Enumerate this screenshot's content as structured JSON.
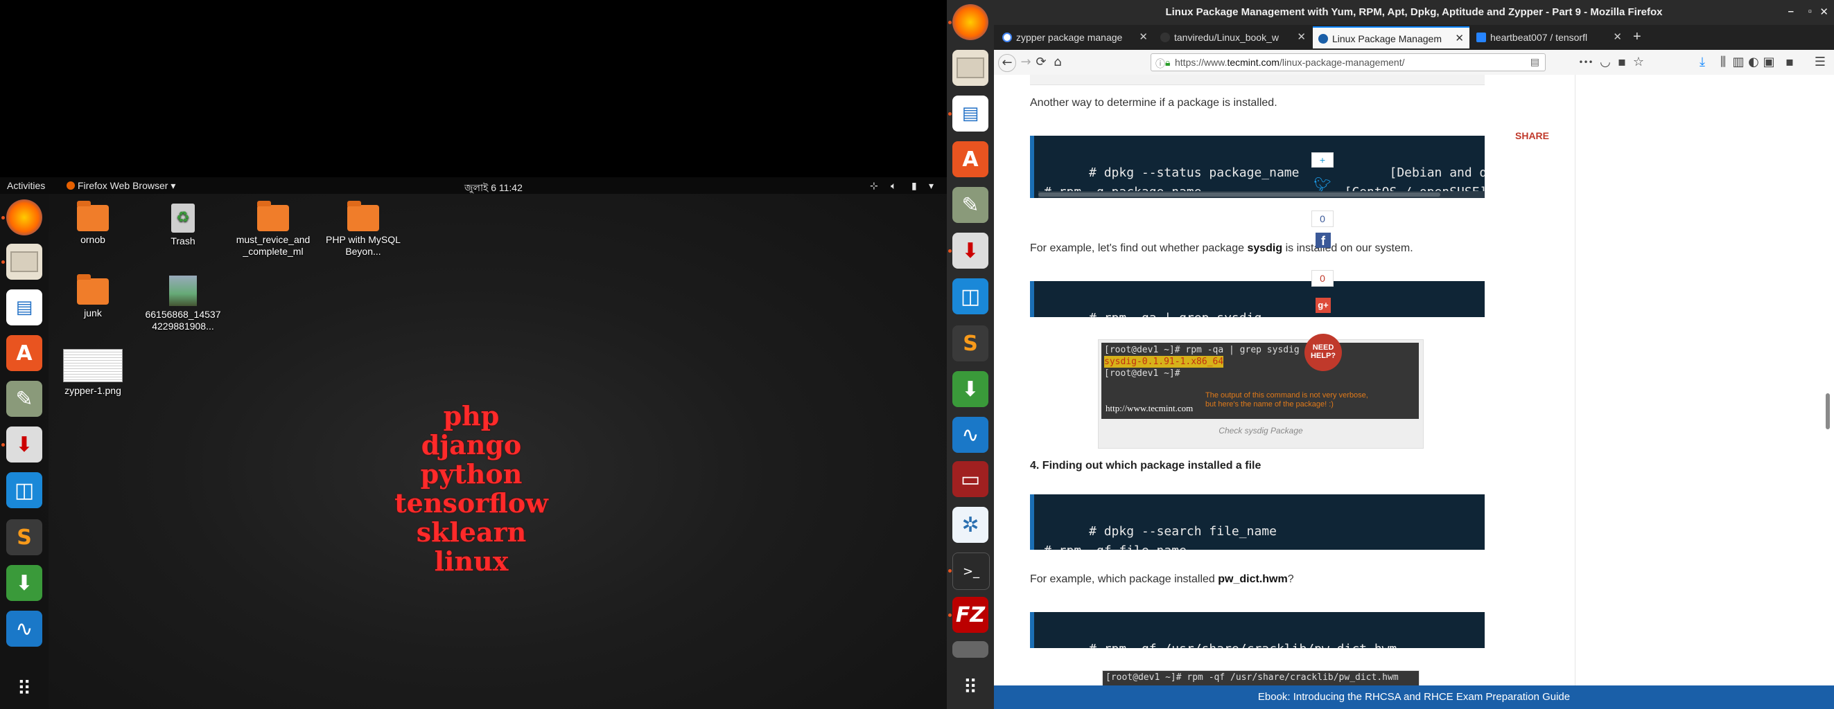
{
  "left_screen": {
    "topbar": {
      "activities": "Activities",
      "app_menu": "Firefox Web Browser",
      "app_menu_caret": "▾",
      "clock": "জুলাই 6  11:42",
      "tray_icons": [
        "network-icon",
        "volume-icon",
        "battery-icon",
        "caret-down-icon"
      ]
    },
    "desktop_items": [
      {
        "label": "ornob",
        "type": "folder-home"
      },
      {
        "label": "Trash",
        "type": "trash"
      },
      {
        "label": "must_revice_and_complete_ml",
        "type": "folder"
      },
      {
        "label": "PHP with MySQL Beyon...",
        "type": "folder"
      },
      {
        "label": "junk",
        "type": "folder"
      },
      {
        "label": "66156868_145374229881908...",
        "type": "image"
      },
      {
        "label": "zypper-1.png",
        "type": "image"
      }
    ],
    "wordcloud": [
      "php",
      "django",
      "python",
      "tensorflow",
      "sklearn",
      "linux"
    ],
    "dock": [
      "firefox-icon",
      "files-icon",
      "writer-icon",
      "software-center-icon",
      "editor-icon",
      "installer-icon",
      "app-icon",
      "sublime-icon",
      "download-icon",
      "monitor-icon",
      "apps-grid-icon"
    ]
  },
  "firefox": {
    "window_title": "Linux Package Management with Yum, RPM, Apt, Dpkg, Aptitude and Zypper - Part 9 - Mozilla Firefox",
    "window_controls": [
      "–",
      "▫",
      "✕"
    ],
    "tabs": [
      {
        "label": "zypper package manage",
        "active": false
      },
      {
        "label": "tanviredu/Linux_book_w",
        "active": false
      },
      {
        "label": "Linux Package Managem",
        "active": true
      },
      {
        "label": "heartbeat007 / tensorfl",
        "active": false
      }
    ],
    "new_tab": "+",
    "url_prefix": "https://www.",
    "url_domain": "tecmint.com",
    "url_path": "/linux-package-management/",
    "nav": {
      "back": "←",
      "forward": "→",
      "reload": "⟳",
      "home": "⌂",
      "more": "•••",
      "menu": "☰"
    }
  },
  "article": {
    "para1": "Another way to determine if a package is installed.",
    "code1": "# dpkg --status package_name            [Debian and derivatives]\n# rpm -q package_name                   [CentOS / openSUSE]",
    "para2_pre": "For example, let's find out whether package ",
    "para2_bold": "sysdig",
    "para2_post": " is installed on our system.",
    "code2": "# rpm -qa | grep sysdig",
    "terminal_lines": [
      "[root@dev1 ~]# rpm -qa | grep sysdig",
      "sysdig-0.1.91-1.x86_64",
      "[root@dev1 ~]# "
    ],
    "terminal_note": "The output of this command is not very verbose,\nbut here's the name of the package! :)",
    "terminal_watermark": "http://www.tecmint.com",
    "caption": "Check sysdig Package",
    "heading4": "4. Finding out which package installed a file",
    "code3": "# dpkg --search file_name\n# rpm -qf file_name",
    "para3_pre": "For example, which package installed ",
    "para3_bold": "pw_dict.hwm",
    "para3_post": "?",
    "code4": "# rpm -qf /usr/share/cracklib/pw_dict.hwm",
    "terminal2_line": "[root@dev1 ~]# rpm -qf /usr/share/cracklib/pw_dict.hwm"
  },
  "share": {
    "label": "SHARE",
    "plus": "+",
    "twitter_count": "0",
    "facebook_count": "0",
    "help": "NEED HELP?"
  },
  "footer": "Ebook: Introducing the RHCSA and RHCE Exam Preparation Guide"
}
